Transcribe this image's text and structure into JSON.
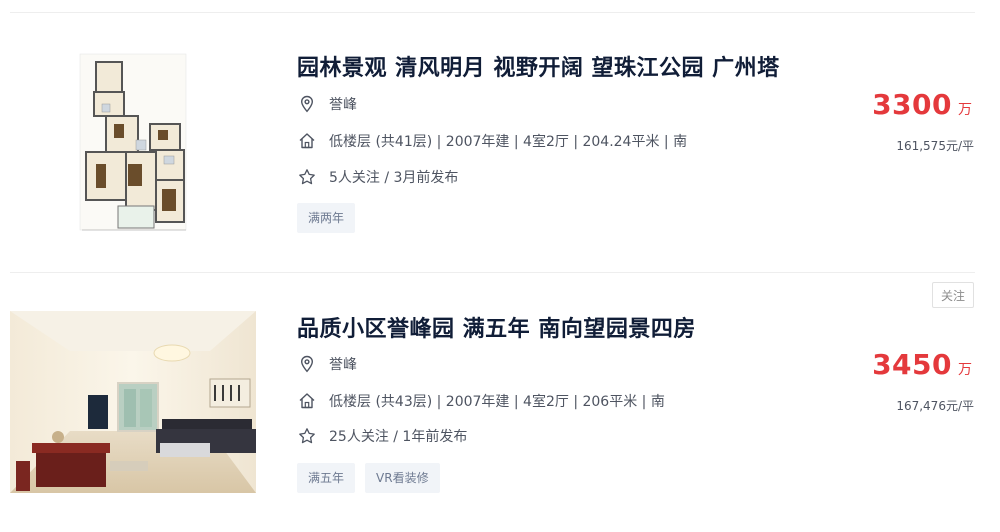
{
  "listings": [
    {
      "title": "园林景观 清风明月 视野开阔 望珠江公园 广州塔",
      "community": "誉峰",
      "house_info": "低楼层 (共41层) | 2007年建 | 4室2厅 | 204.24平米 | 南",
      "follow_info": "5人关注 / 3月前发布",
      "tags": [
        "满两年"
      ],
      "total_price": "3300",
      "price_unit": "万",
      "unit_price": "161,575元/平",
      "image": "floor-plan"
    },
    {
      "title": "品质小区誉峰园 满五年 南向望园景四房",
      "community": "誉峰",
      "house_info": "低楼层 (共43层) | 2007年建 | 4室2厅 | 206平米 | 南",
      "follow_info": "25人关注 / 1年前发布",
      "tags": [
        "满五年",
        "VR看装修"
      ],
      "total_price": "3450",
      "price_unit": "万",
      "unit_price": "167,476元/平",
      "follow_button": "关注",
      "image": "living-room-photo"
    }
  ],
  "colors": {
    "price": "#e4393c",
    "title": "#101d37",
    "tag_bg": "#f1f4f8",
    "tag_text": "#6e7a91"
  },
  "icons": {
    "location": "location-pin-icon",
    "house": "house-icon",
    "star": "star-icon"
  }
}
